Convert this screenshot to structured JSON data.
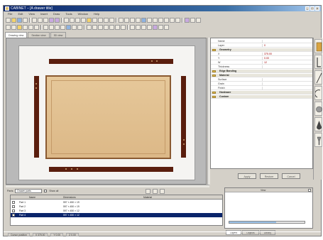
{
  "window": {
    "title": "CABINET – [A drawer title]"
  },
  "menu": [
    "File",
    "Edit",
    "View",
    "Insert",
    "Draw",
    "Tools",
    "Window",
    "Help"
  ],
  "doc_tabs": [
    "Drawing view",
    "Section view",
    "3D view"
  ],
  "properties": {
    "rows": [
      {
        "type": "prop",
        "name": "Name",
        "value": ""
      },
      {
        "type": "prop",
        "name": "Layer",
        "value": "0"
      },
      {
        "type": "cat",
        "name": "Geometry"
      },
      {
        "type": "prop",
        "name": "X",
        "value": "375.00"
      },
      {
        "type": "prop",
        "name": "Y",
        "value": "0.00"
      },
      {
        "type": "prop",
        "name": "W",
        "value": "12"
      },
      {
        "type": "prop",
        "name": "Thickness",
        "value": ""
      },
      {
        "type": "cat",
        "name": "Edge Banding"
      },
      {
        "type": "cat",
        "name": "Material"
      },
      {
        "type": "prop",
        "name": "Surface",
        "value": ""
      },
      {
        "type": "prop",
        "name": "Grain",
        "value": ""
      },
      {
        "type": "prop",
        "name": "Finish",
        "value": ""
      },
      {
        "type": "cat",
        "name": "Hardware"
      },
      {
        "type": "cat",
        "name": "Custom"
      }
    ]
  },
  "actions": {
    "apply": "Apply",
    "reset": "Restore",
    "cancel": "Cancel"
  },
  "lower": {
    "label": "Parts",
    "select": "Drawer parts",
    "check_label": "Show all"
  },
  "table": {
    "columns": [
      "Name",
      "Dimensions",
      "Material"
    ],
    "rows": [
      {
        "name": "Part 1",
        "dims": "597 × 450 × 19",
        "material": ""
      },
      {
        "name": "Part 2",
        "dims": "597 × 450 × 19",
        "material": ""
      },
      {
        "name": "Part 3",
        "dims": "597 × 450 × 12",
        "material": ""
      },
      {
        "name": "Part 4",
        "dims": "597 × 450 × 12",
        "material": ""
      }
    ]
  },
  "right_panel": {
    "title": "View",
    "progress": 0.62
  },
  "right_tabs": [
    "Layers",
    "Objects",
    "Library"
  ],
  "status": [
    "Cursor position",
    "X 375.00",
    "Y 0.00",
    "Z 0.00"
  ],
  "colors": {
    "wood_dark": "#5a1e0e",
    "wood_light": "#e6c89a",
    "title": "#0a246a"
  }
}
